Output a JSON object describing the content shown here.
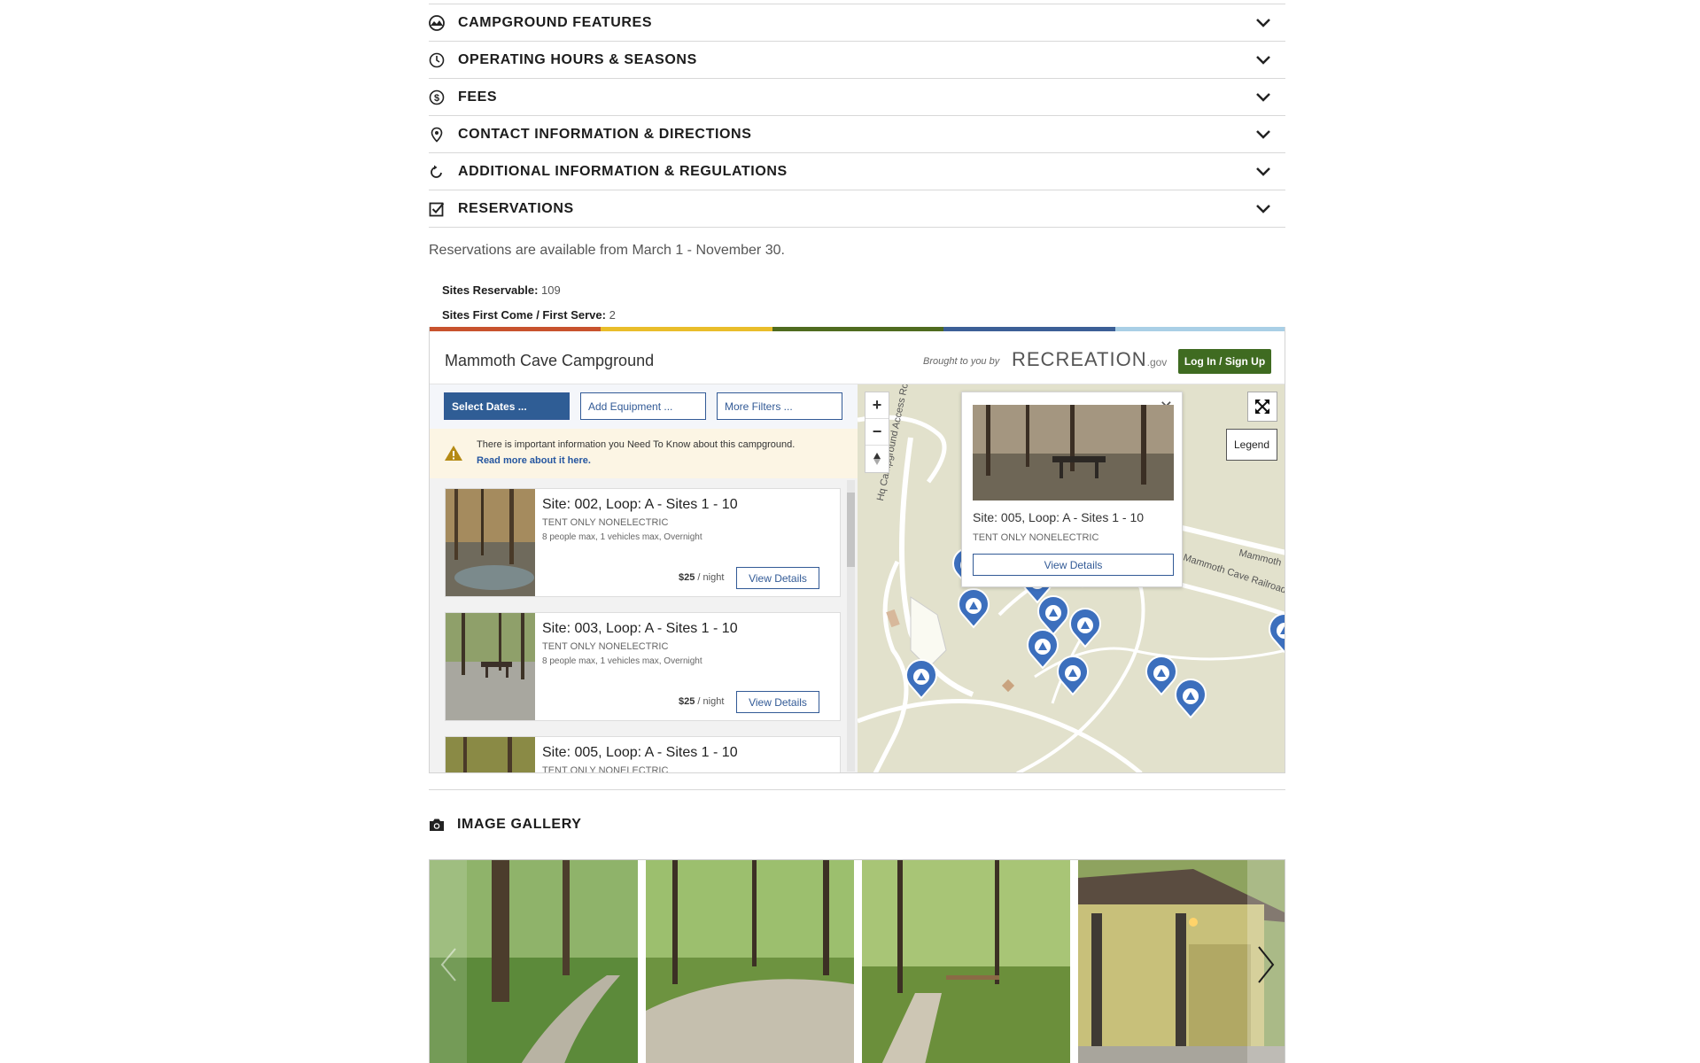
{
  "accordion": [
    {
      "label": "CAMPGROUND FEATURES",
      "icon": "mountain-icon"
    },
    {
      "label": "OPERATING HOURS & SEASONS",
      "icon": "clock-icon"
    },
    {
      "label": "FEES",
      "icon": "dollar-icon"
    },
    {
      "label": "CONTACT INFORMATION & DIRECTIONS",
      "icon": "location-pin-icon"
    },
    {
      "label": "ADDITIONAL INFORMATION & REGULATIONS",
      "icon": "refresh-icon"
    },
    {
      "label": "RESERVATIONS",
      "icon": "checkbox-icon"
    }
  ],
  "reservations": {
    "text": "Reservations are available from March 1 - November 30.",
    "sites_reservable_label": "Sites Reservable:",
    "sites_reservable": "109",
    "sites_fcfs_label": "Sites First Come / First Serve:",
    "sites_fcfs": "2"
  },
  "widget": {
    "title": "Mammoth Cave Campground",
    "brought_by": "Brought to you by",
    "logo_main": "RECREATION",
    "logo_suffix": ".gov",
    "login": "Log In / Sign Up",
    "filters": [
      "Select Dates ...",
      "Add Equipment ...",
      "More Filters ..."
    ],
    "notice_text": "There is important information you Need To Know about this campground.",
    "notice_link": "Read more about it here.",
    "rainbow_colors": [
      "#c8532e",
      "#e9bd2a",
      "#4f6b1f",
      "#3c5f96",
      "#a9cfe6"
    ],
    "accent": "#3f6b21",
    "sites": [
      {
        "site": "Site: 002, Loop: A - Sites 1 - 10",
        "type": "TENT ONLY NONELECTRIC",
        "capacity": "8 people max, 1 vehicles max, Overnight",
        "price": "$25",
        "per": "/ night",
        "button": "View Details"
      },
      {
        "site": "Site: 003, Loop: A - Sites 1 - 10",
        "type": "TENT ONLY NONELECTRIC",
        "capacity": "8 people max, 1 vehicles max, Overnight",
        "price": "$25",
        "per": "/ night",
        "button": "View Details"
      },
      {
        "site": "Site: 005, Loop: A - Sites 1 - 10",
        "type": "TENT ONLY NONELECTRIC"
      }
    ],
    "map": {
      "zoom_in": "+",
      "zoom_out": "−",
      "legend": "Legend",
      "road1": "Hq Campground Access Road",
      "road2": "Mammoth Cave Railroad",
      "road3": "Mammoth",
      "popup": {
        "site": "Site: 005, Loop: A - Sites 1 - 10",
        "type": "TENT ONLY NONELECTRIC",
        "button": "View Details"
      }
    }
  },
  "gallery": {
    "title": "IMAGE GALLERY"
  }
}
